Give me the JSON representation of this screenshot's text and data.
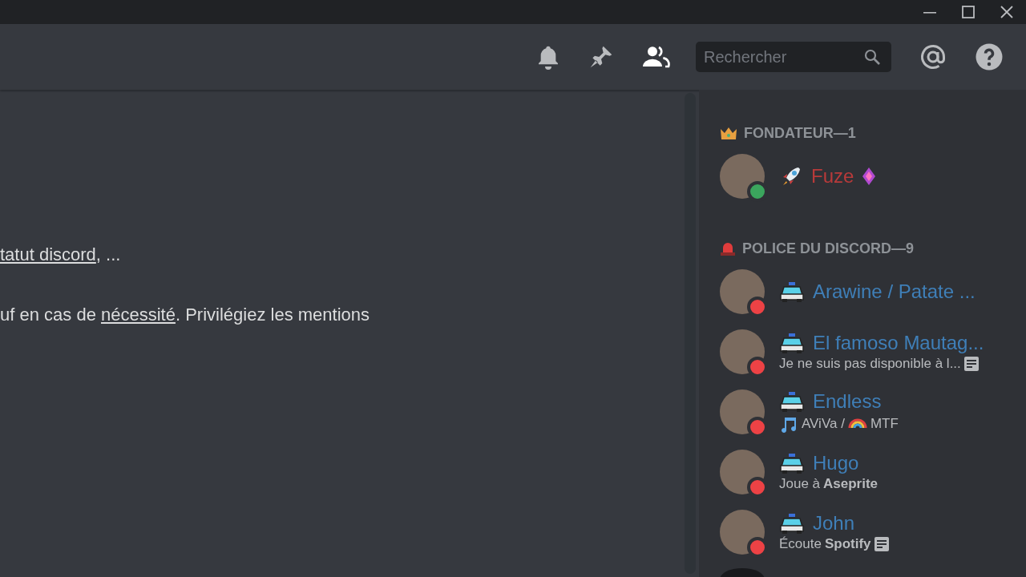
{
  "header": {
    "search": {
      "placeholder": "Rechercher"
    },
    "members_toggle": {
      "selected": true
    }
  },
  "messages": [
    {
      "segments": [
        {
          "text": "tatut discord",
          "link": true
        },
        {
          "text": ", ...",
          "link": false
        }
      ]
    },
    {
      "segments": [
        {
          "text": "uf en cas de ",
          "link": false
        },
        {
          "text": "nécessité",
          "link": true
        },
        {
          "text": ". Privilégiez les mentions",
          "link": false
        }
      ]
    }
  ],
  "member_list": {
    "groups": [
      {
        "kind": "founder",
        "title": "FONDATEUR—1",
        "members": [
          {
            "name": "Fuze",
            "color": "#b83a3a",
            "do_not_disturb": false,
            "kind": "rocket",
            "boost": true
          }
        ]
      },
      {
        "kind": "police",
        "title": "POLICE DU DISCORD—9",
        "members": [
          {
            "name": "Arawine / Patate ...",
            "color": "#3f7fb8",
            "do_not_disturb": true,
            "kind": "car",
            "boost": false
          },
          {
            "name": "El famoso Mautag...",
            "color": "#3f7fb8",
            "do_not_disturb": true,
            "kind": "car",
            "boost": false,
            "activity": [
              {
                "kind": "text",
                "text": "Je ne suis pas disponible à l..."
              },
              {
                "kind": "note"
              }
            ]
          },
          {
            "name": "Endless",
            "color": "#3f7fb8",
            "do_not_disturb": true,
            "kind": "car",
            "boost": false,
            "activity": [
              {
                "kind": "music"
              },
              {
                "kind": "text",
                "text": "AViVa /"
              },
              {
                "kind": "rainbow"
              },
              {
                "kind": "text",
                "text": "MTF"
              }
            ]
          },
          {
            "name": "Hugo",
            "color": "#3f7fb8",
            "do_not_disturb": true,
            "kind": "car",
            "boost": false,
            "activity": [
              {
                "kind": "text",
                "text": "Joue à "
              },
              {
                "kind": "bold",
                "text": "Aseprite"
              }
            ]
          },
          {
            "name": "John",
            "color": "#3f7fb8",
            "do_not_disturb": true,
            "kind": "car",
            "boost": false,
            "activity": [
              {
                "kind": "text",
                "text": "Écoute "
              },
              {
                "kind": "bold",
                "text": "Spotify"
              },
              {
                "kind": "note"
              }
            ]
          }
        ]
      }
    ],
    "more_below": true
  }
}
